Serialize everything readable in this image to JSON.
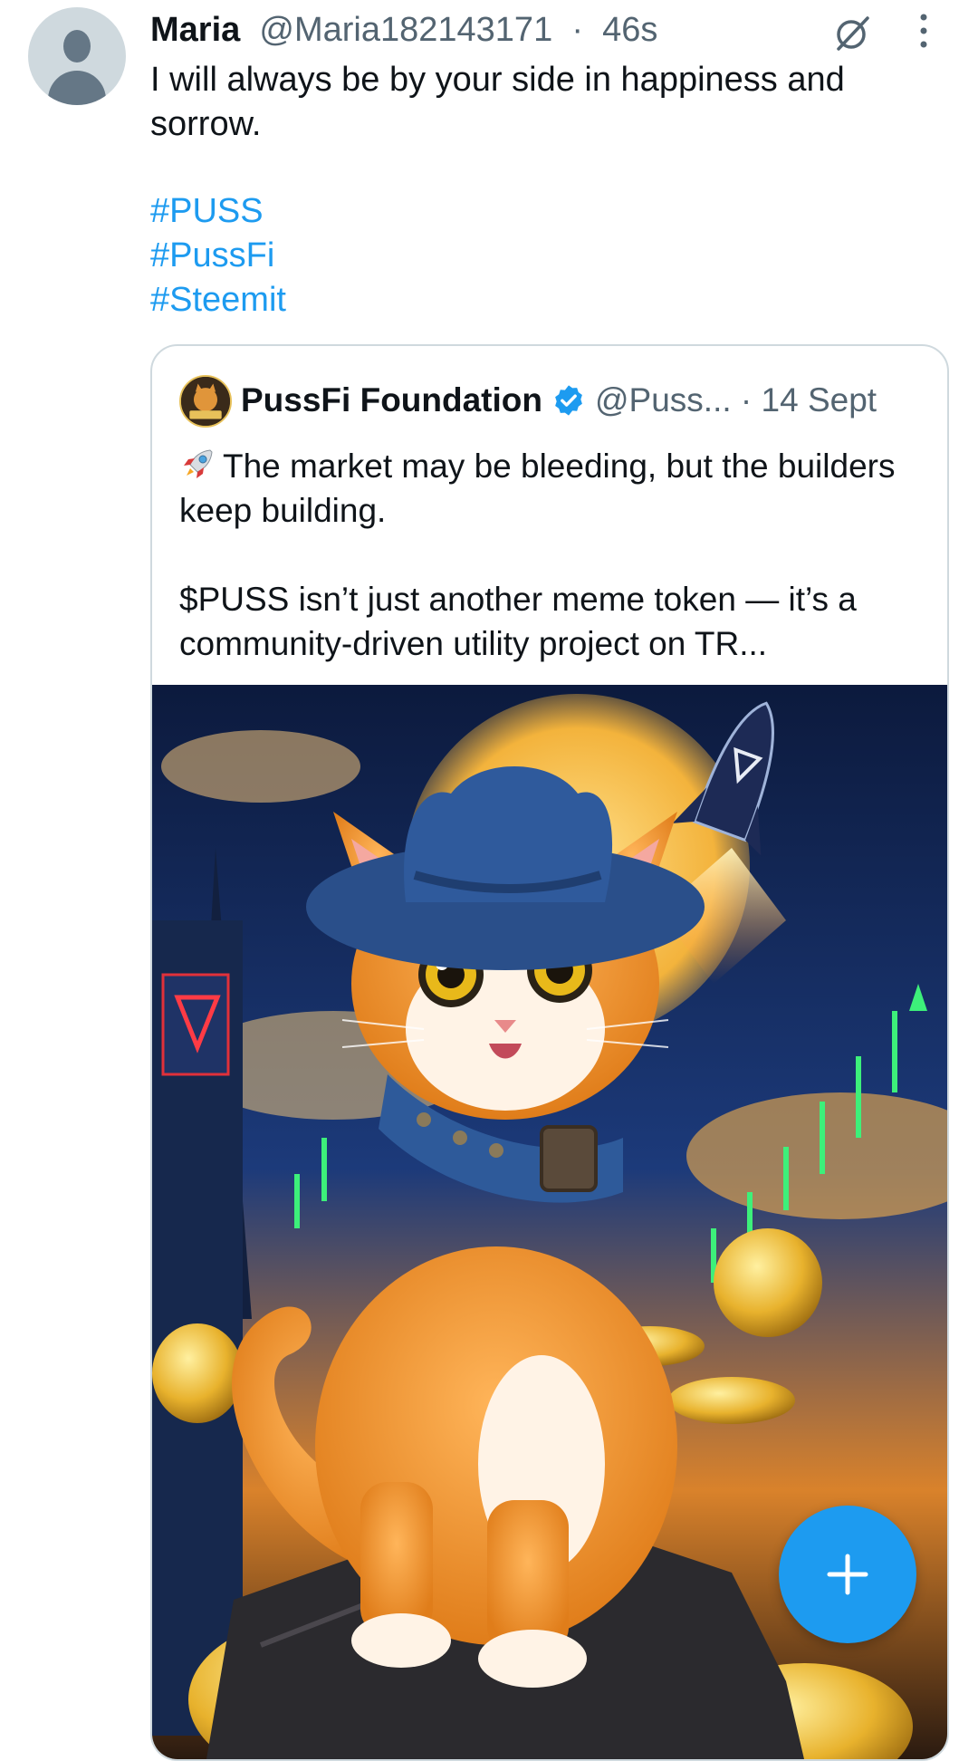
{
  "tweet": {
    "author_name": "Maria",
    "author_handle": "@Maria182143171",
    "separator": "·",
    "time": "46s",
    "text": "I will always be by your side in happiness and sorrow.",
    "hashtags": [
      "#PUSS",
      "#PussFi",
      "#Steemit"
    ]
  },
  "quote": {
    "author_name": "PussFi Foundation",
    "author_handle": "@Puss...",
    "separator": "·",
    "date": "14 Sept",
    "paragraphs": [
      "The market may be bleeding, but the builders keep building.",
      "$PUSS isn’t just another meme token — it’s a community-driven utility project on TR..."
    ]
  },
  "icons": {
    "avatar": "default-avatar-icon",
    "grok": "grok-icon",
    "more": "more-vertical-icon",
    "verified": "verified-badge-icon",
    "rocket": "rocket-emoji-icon",
    "compose": "plus-icon"
  },
  "colors": {
    "link": "#1d9bf0",
    "secondary_text": "#536471",
    "primary_text": "#0f1419",
    "fab": "#1d9bf0"
  }
}
